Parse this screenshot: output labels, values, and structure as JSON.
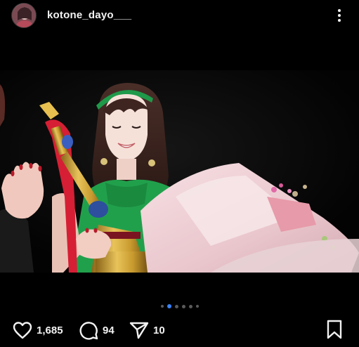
{
  "header": {
    "username": "kotone_dayo___",
    "avatar_icon": "profile-avatar",
    "more_icon": "more-vertical-icon"
  },
  "media": {
    "carousel_total": 6,
    "carousel_active_index": 1
  },
  "actions": {
    "likes_count": "1,685",
    "comments_count": "94",
    "shares_count": "10",
    "like_icon": "heart-icon",
    "comment_icon": "comment-bubble-icon",
    "share_icon": "send-icon",
    "save_icon": "bookmark-icon"
  },
  "colors": {
    "background": "#000000",
    "text": "#f2f2f2",
    "carousel_active": "#3b82f6",
    "carousel_inactive": "#5a5a5a"
  }
}
